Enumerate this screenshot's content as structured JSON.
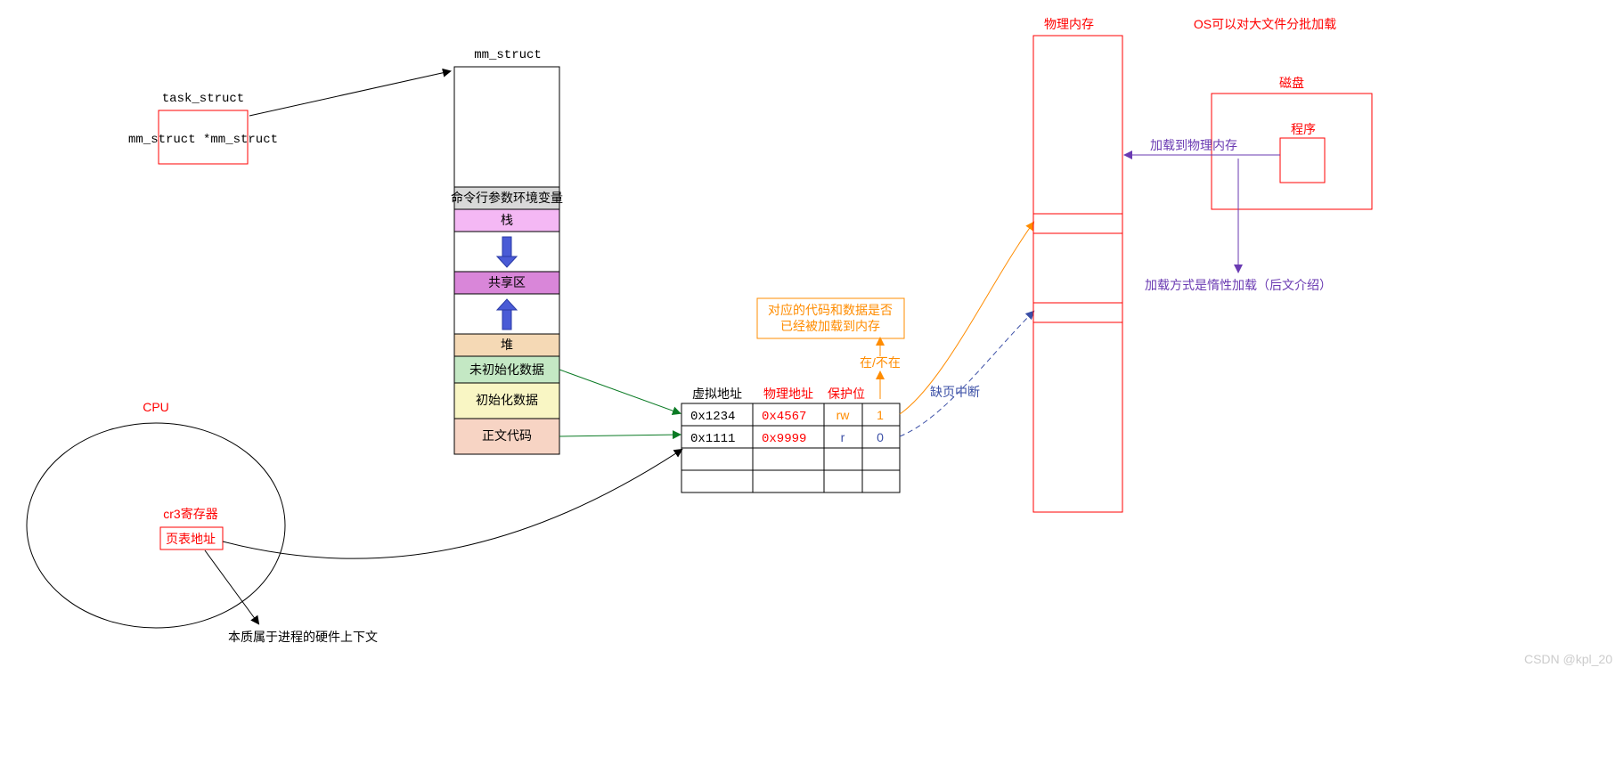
{
  "task_struct": {
    "title": "task_struct",
    "member": "mm_struct *mm_struct"
  },
  "mm_struct": {
    "title": "mm_struct",
    "segments": {
      "cmdline_env": "命令行参数环境变量",
      "stack": "栈",
      "shared": "共享区",
      "heap": "堆",
      "bss": "未初始化数据",
      "data": "初始化数据",
      "text": "正文代码"
    }
  },
  "cpu": {
    "title": "CPU",
    "cr3_label": "cr3寄存器",
    "cr3_value": "页表地址",
    "note": "本质属于进程的硬件上下文"
  },
  "page_table": {
    "headers": {
      "vaddr": "虚拟地址",
      "paddr": "物理地址",
      "prot": "保护位"
    },
    "rows": [
      {
        "vaddr": "0x1234",
        "paddr": "0x4567",
        "prot": "rw",
        "present": "1"
      },
      {
        "vaddr": "0x1111",
        "paddr": "0x9999",
        "prot": "r",
        "present": "0"
      }
    ],
    "present_label": "在/不在",
    "note": "对应的代码和数据是否已经被加载到内存",
    "page_fault": "缺页中断"
  },
  "phys_mem": {
    "title": "物理内存"
  },
  "disk": {
    "title": "磁盘",
    "program": "程序",
    "load_to_mem": "加载到物理内存",
    "lazy_note": "加载方式是惰性加载（后文介绍）",
    "batch_note": "OS可以对大文件分批加载"
  },
  "watermark": "CSDN @kpl_20"
}
